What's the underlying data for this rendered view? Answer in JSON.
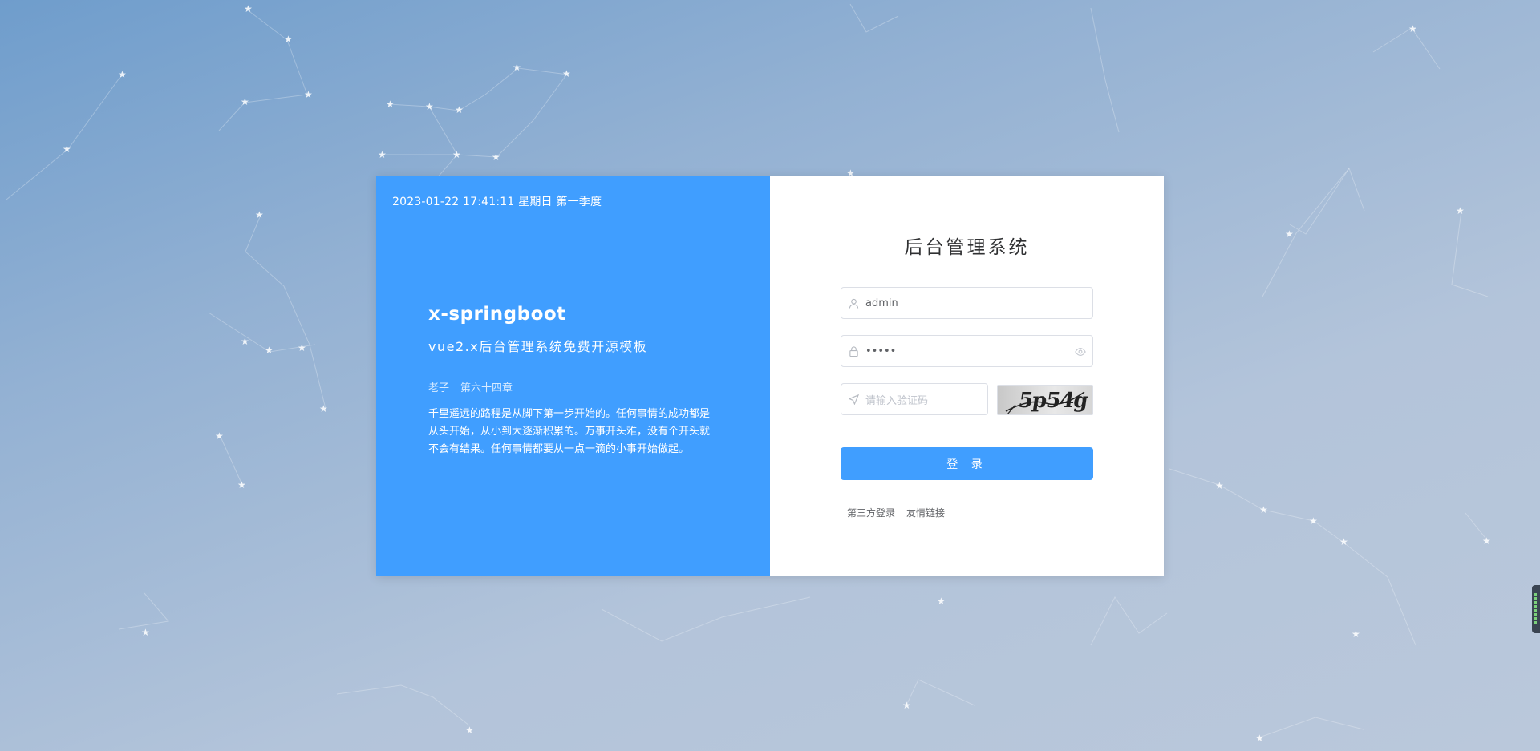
{
  "left": {
    "datetime": "2023-01-22 17:41:11 星期日 第一季度",
    "brand_title": "x-springboot",
    "brand_subtitle": "vue2.x后台管理系统免费开源模板",
    "quote_author": "老子",
    "quote_chapter": "第六十四章",
    "quote_text": "千里遥远的路程是从脚下第一步开始的。任何事情的成功都是从头开始，从小到大逐渐积累的。万事开头难，没有个开头就不会有结果。任何事情都要从一点一滴的小事开始做起。"
  },
  "form": {
    "title": "后台管理系统",
    "username_value": "admin",
    "password_value": "•••••",
    "captcha_placeholder": "请输入验证码",
    "captcha_code": "5p54g",
    "login_label": "登 录",
    "third_party_label": "第三方登录",
    "friend_links_label": "友情链接"
  },
  "icons": {
    "username": "user-icon",
    "password": "lock-icon",
    "captcha": "send-icon",
    "toggle": "eye-icon"
  },
  "colors": {
    "primary": "#409eff",
    "background": "#a9bed8"
  }
}
